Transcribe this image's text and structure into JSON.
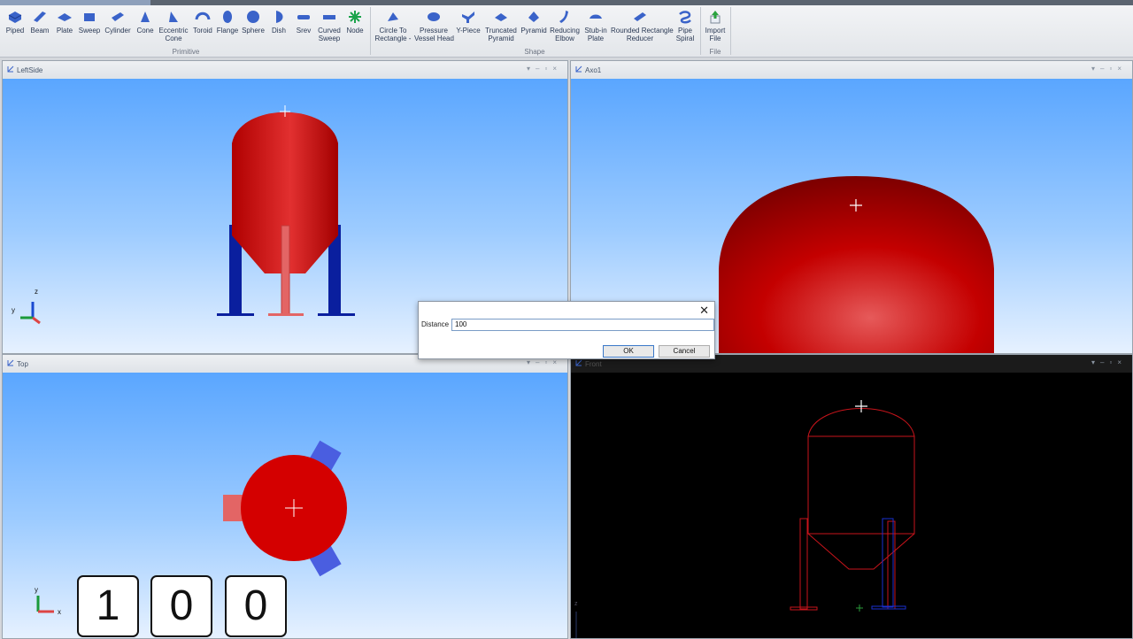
{
  "ribbon": {
    "buttons": [
      {
        "label": "Piped",
        "icon": "piped-icon"
      },
      {
        "label": "Beam",
        "icon": "beam-icon"
      },
      {
        "label": "Plate",
        "icon": "plate-icon"
      },
      {
        "label": "Sweep",
        "icon": "sweep-icon"
      },
      {
        "label": "Cylinder",
        "icon": "cylinder-icon"
      },
      {
        "label": "Cone",
        "icon": "cone-icon"
      },
      {
        "label": "Eccentric\nCone",
        "icon": "eccentric-cone-icon"
      },
      {
        "label": "Toroid",
        "icon": "toroid-icon"
      },
      {
        "label": "Flange",
        "icon": "flange-icon"
      },
      {
        "label": "Sphere",
        "icon": "sphere-icon"
      },
      {
        "label": "Dish",
        "icon": "dish-icon"
      },
      {
        "label": "Srev",
        "icon": "srev-icon"
      },
      {
        "label": "Curved\nSweep",
        "icon": "curved-sweep-icon"
      },
      {
        "label": "Node",
        "icon": "node-icon"
      },
      {
        "label": "Circle To\nRectangle -",
        "icon": "circle-to-rectangle-icon"
      },
      {
        "label": "Pressure\nVessel Head",
        "icon": "pressure-vessel-head-icon"
      },
      {
        "label": "Y-Piece",
        "icon": "y-piece-icon"
      },
      {
        "label": "Truncated\nPyramid",
        "icon": "truncated-pyramid-icon"
      },
      {
        "label": "Pyramid",
        "icon": "pyramid-icon"
      },
      {
        "label": "Reducing\nElbow",
        "icon": "reducing-elbow-icon"
      },
      {
        "label": "Stub-in\nPlate",
        "icon": "stub-in-plate-icon"
      },
      {
        "label": "Rounded Rectangle\nReducer",
        "icon": "rounded-rectangle-reducer-icon"
      },
      {
        "label": "Pipe\nSpiral",
        "icon": "pipe-spiral-icon"
      },
      {
        "label": "Import\nFile",
        "icon": "import-file-icon"
      }
    ],
    "groups": {
      "primitive": "Primitive",
      "shape": "Shape",
      "file": "File"
    }
  },
  "viewports": {
    "leftside": {
      "title": "LeftSide",
      "axis_y": "y",
      "axis_z": "z"
    },
    "axo": {
      "title": "Axo1"
    },
    "top": {
      "title": "Top",
      "axis_y": "y",
      "axis_x": "x"
    },
    "front": {
      "title": "Front",
      "axis_z": "z"
    }
  },
  "dialog": {
    "label": "Distance",
    "value": "100",
    "ok": "OK",
    "cancel": "Cancel",
    "close": "✕"
  },
  "keys": [
    "1",
    "0",
    "0"
  ],
  "colors": {
    "vessel": "#cc0000",
    "legs": "#0a1f9e",
    "sky_top": "#5aa6ff",
    "sky_bottom": "#e6f1ff",
    "wire": "#c8141b"
  }
}
